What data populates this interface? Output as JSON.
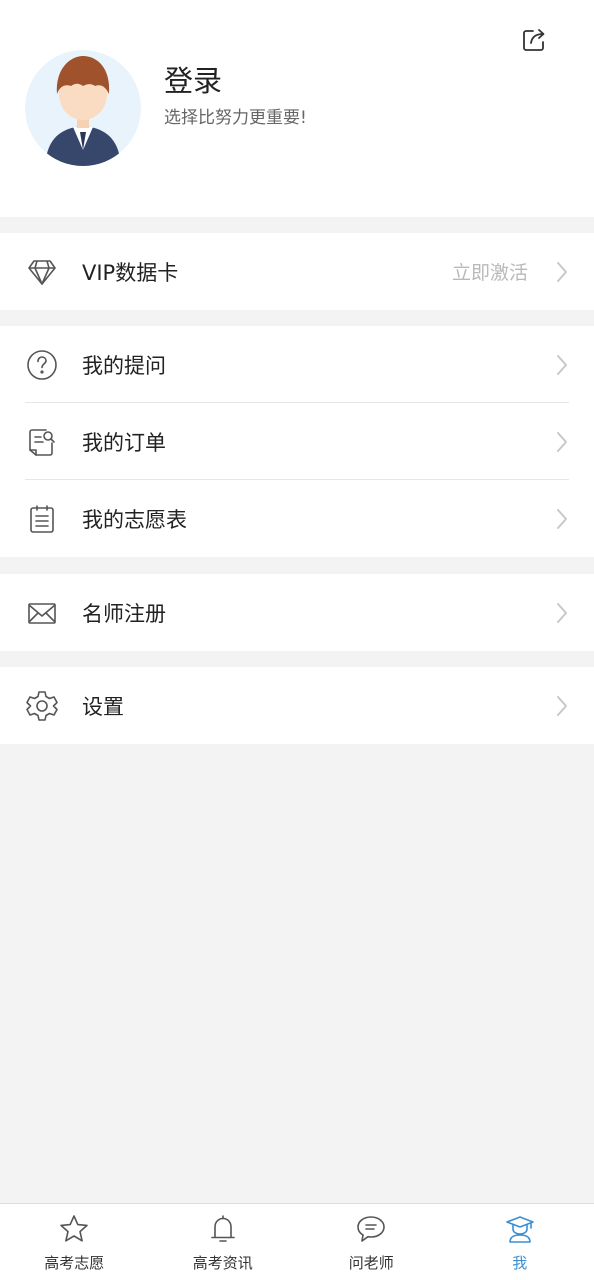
{
  "header": {
    "title": "登录",
    "subtitle": "选择比努力更重要!",
    "share_icon": "share-icon",
    "avatar_icon": "avatar-image"
  },
  "groups": [
    {
      "items": [
        {
          "label": "VIP数据卡",
          "icon": "diamond-icon",
          "right_text": "立即激活"
        }
      ]
    },
    {
      "items": [
        {
          "label": "我的提问",
          "icon": "question-icon"
        },
        {
          "label": "我的订单",
          "icon": "order-icon"
        },
        {
          "label": "我的志愿表",
          "icon": "clipboard-icon"
        }
      ]
    },
    {
      "items": [
        {
          "label": "名师注册",
          "icon": "envelope-icon"
        }
      ]
    },
    {
      "items": [
        {
          "label": "设置",
          "icon": "gear-icon"
        }
      ]
    }
  ],
  "tabbar": {
    "tabs": [
      {
        "label": "高考志愿",
        "icon": "star-icon",
        "active": false
      },
      {
        "label": "高考资讯",
        "icon": "bell-icon",
        "active": false
      },
      {
        "label": "问老师",
        "icon": "chat-bubble-icon",
        "active": false
      },
      {
        "label": "我",
        "icon": "graduate-icon",
        "active": true
      }
    ]
  },
  "colors": {
    "accent": "#3a8fd3",
    "page_bg": "#f3f3f3",
    "muted_text": "#b9b9b9",
    "avatar_bg": "#e8f3fc",
    "hair": "#a0522d",
    "suit": "#36476b"
  }
}
